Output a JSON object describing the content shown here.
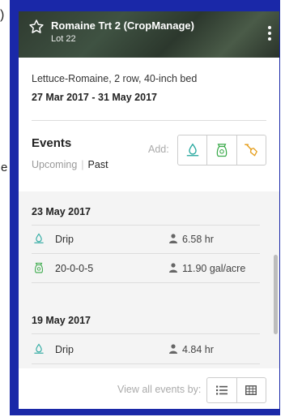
{
  "page_fragments": {
    "paren": ")",
    "letter_e": "e"
  },
  "header": {
    "title": "Romaine Trt 2 (CropManage)",
    "subtitle": "Lot 22",
    "star_icon": "star-outline-icon",
    "menu_icon": "kebab-menu-icon"
  },
  "planting": {
    "description": "Lettuce-Romaine, 2 row, 40-inch bed",
    "date_range": "27 Mar 2017 - 31 May 2017"
  },
  "events": {
    "title": "Events",
    "tabs": {
      "upcoming": "Upcoming",
      "separator": "|",
      "past": "Past"
    },
    "add_label": "Add:",
    "add_buttons": [
      "water-drop-icon",
      "fertilizer-bag-icon",
      "shovel-icon"
    ],
    "groups": [
      {
        "date": "23 May 2017",
        "items": [
          {
            "name": "Drip",
            "value": "6.58 hr",
            "icon": "water-drop-icon"
          },
          {
            "name": "20-0-0-5",
            "value": "11.90 gal/acre",
            "icon": "fertilizer-bag-icon"
          }
        ]
      },
      {
        "date": "19 May 2017",
        "items": [
          {
            "name": "Drip",
            "value": "4.84 hr",
            "icon": "water-drop-icon"
          }
        ]
      }
    ]
  },
  "footer": {
    "view_label": "View all events by:",
    "view_buttons": [
      "list-icon",
      "table-icon"
    ]
  },
  "colors": {
    "teal": "#2aa9a0",
    "green": "#3aaa4a",
    "orange": "#e6a020",
    "frame_blue": "#1a28a8"
  }
}
